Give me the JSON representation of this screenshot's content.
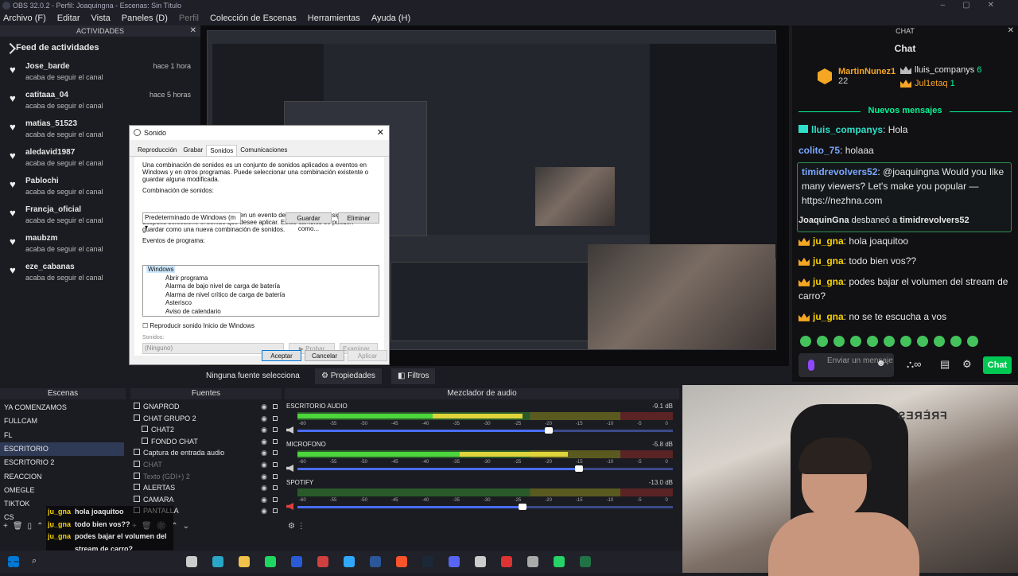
{
  "window": {
    "title": "OBS 32.0.2 - Perfil: Joaquingna - Escenas: Sin Título"
  },
  "menu": [
    "Archivo (F)",
    "Editar",
    "Vista",
    "Paneles (D)",
    "Perfil",
    "Colección de Escenas",
    "Herramientas",
    "Ayuda (H)"
  ],
  "activities": {
    "header": "ACTIVIDADES",
    "title": "Feed de actividades",
    "items": [
      {
        "name": "Jose_barde",
        "sub": "acaba de seguir el canal",
        "time": "hace 1 hora"
      },
      {
        "name": "catitaaa_04",
        "sub": "acaba de seguir el canal",
        "time": "hace 5 horas"
      },
      {
        "name": "matias_51523",
        "sub": "acaba de seguir el canal",
        "time": ""
      },
      {
        "name": "aledavid1987",
        "sub": "acaba de seguir el canal",
        "time": ""
      },
      {
        "name": "Pablochi",
        "sub": "acaba de seguir el canal",
        "time": ""
      },
      {
        "name": "Francja_oficial",
        "sub": "acaba de seguir el canal",
        "time": ""
      },
      {
        "name": "maubzm",
        "sub": "acaba de seguir el canal",
        "time": ""
      },
      {
        "name": "eze_cabanas",
        "sub": "acaba de seguir el canal",
        "time": ""
      }
    ]
  },
  "dialog": {
    "title": "Sonido",
    "tabs": [
      "Reproducción",
      "Grabar",
      "Sonidos",
      "Comunicaciones"
    ],
    "p1": "Una combinación de sonidos es un conjunto de sonidos aplicados a eventos en Windows y en otros programas. Puede seleccionar una combinación existente o guardar alguna modificada.",
    "scheme_label": "Combinación de sonidos:",
    "scheme_value": "Predeterminado de Windows (m",
    "save_as": "Guardar como...",
    "delete": "Eliminar",
    "p2": "Para cambiar un sonido, haga clic en un evento de programa de la siguiente lista y después seleccione el sonido que desee aplicar. Estos cambios se pueden guardar como una nueva combinación de sonidos.",
    "events_label": "Eventos de programa:",
    "events": [
      "Windows",
      "Abrir programa",
      "Alarma de bajo nivel de carga de batería",
      "Alarma de nivel crítico de carga de batería",
      "Asterisco",
      "Aviso de calendario"
    ],
    "startup_check": "Reproducir sonido Inicio de Windows",
    "sounds_label": "Sonidos:",
    "sounds_value": "(Ninguno)",
    "test": "Probar",
    "browse": "Examinar...",
    "accept": "Aceptar",
    "cancel": "Cancelar",
    "apply": "Aplicar"
  },
  "source_bar": {
    "none": "Ninguna fuente selecciona",
    "properties": "Propiedades",
    "filters": "Filtros"
  },
  "chat": {
    "header": "CHAT",
    "title": "Chat",
    "leaders": [
      {
        "name": "MartinNunez1",
        "count": "22"
      },
      {
        "name": "lluis_companys",
        "count": "6"
      },
      {
        "name": "Jul1etaq",
        "count": "1"
      }
    ],
    "new_messages": "Nuevos mensajes",
    "messages": [
      {
        "user": "lluis_companys",
        "text": ": Hola"
      },
      {
        "user": "colito_75",
        "text": ": holaaa"
      },
      {
        "user": "timidrevolvers52",
        "text": ": @joaquingna Would you like many viewers? Let's make you popular — https://nezhna.com"
      },
      {
        "user": "JoaquinGna",
        "text": " desbaneó a ",
        "target": "timidrevolvers52"
      },
      {
        "user": "ju_gna",
        "text": ": hola joaquitoo"
      },
      {
        "user": "ju_gna",
        "text": ": todo bien vos??"
      },
      {
        "user": "ju_gna",
        "text": ": podes bajar el volumen del stream de carro?"
      },
      {
        "user": "ju_gna",
        "text": ": no se te escucha a vos"
      }
    ],
    "input_placeholder": "Enviar un mensaje",
    "send": "Chat"
  },
  "scenes": {
    "header": "Escenas",
    "items": [
      "YA COMENZAMOS",
      "FULLCAM",
      "FL",
      "ESCRITORIO",
      "ESCRITORIO 2",
      "REACCION",
      "OMEGLE",
      "TIKTOK",
      "CS"
    ],
    "active": "ESCRITORIO"
  },
  "sources": {
    "header": "Fuentes",
    "items": [
      "GNAPROD",
      "CHAT GRUPO 2",
      "CHAT2",
      "FONDO CHAT",
      "Captura de entrada audio",
      "CHAT",
      "Texto (GDI+) 2",
      "ALERTAS",
      "CAMARA",
      "PANTALLA"
    ]
  },
  "mixer": {
    "header": "Mezclador de audio",
    "ticks": [
      "-60",
      "-55",
      "-50",
      "-45",
      "-40",
      "-35",
      "-30",
      "-25",
      "-20",
      "-15",
      "-10",
      "-5",
      "0"
    ],
    "channels": [
      {
        "name": "ESCRITORIO AUDIO",
        "db": "-9.1 dB",
        "level": 0.6,
        "volume": 0.67
      },
      {
        "name": "MICROFONO",
        "db": "-5.8 dB",
        "level": 0.72,
        "volume": 0.75
      },
      {
        "name": "SPOTIFY",
        "db": "-13.0 dB",
        "level": 0.0,
        "volume": 0.6
      }
    ]
  },
  "overlay_chat": [
    {
      "user": "ju_gna",
      "text": "hola joaquitoo"
    },
    {
      "user": "ju_gna",
      "text": "todo bien vos??"
    },
    {
      "user": "ju_gna",
      "text": "podes bajar el volumen del"
    },
    {
      "user": "",
      "text": "stream de carro?"
    },
    {
      "user": "ju_gna",
      "text": "no se te escucha a vos"
    }
  ],
  "webcam_text": "FRÈRES",
  "colors": {
    "accent": "#00f593",
    "send": "#00c853",
    "crown": "#f5a623",
    "username": "#2ee0c9"
  }
}
